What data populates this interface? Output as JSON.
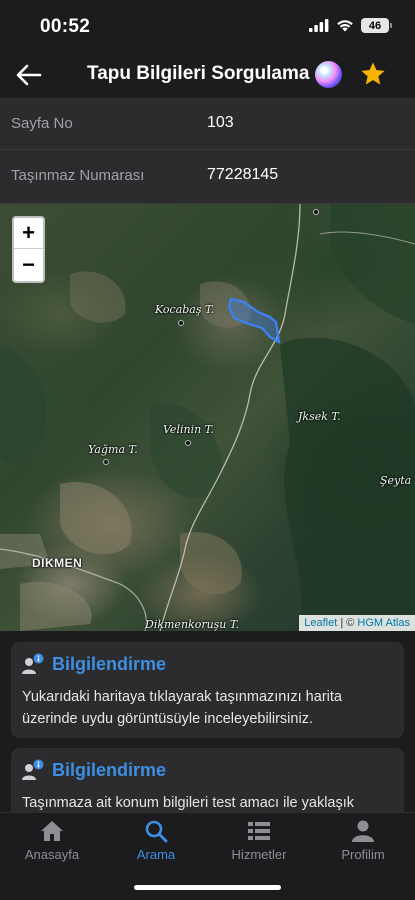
{
  "status_bar": {
    "time": "00:52",
    "battery": "46"
  },
  "nav": {
    "title": "Tapu Bilgileri Sorgulama"
  },
  "info_rows": [
    {
      "label": "Sayfa No",
      "value": "103"
    },
    {
      "label": "Taşınmaz Numarası",
      "value": "77228145"
    }
  ],
  "map": {
    "zoom_in": "+",
    "zoom_out": "−",
    "places": [
      "Kocabaş T.",
      "Jksek T.",
      "Velinin T.",
      "Yağma T.",
      "Şeyta",
      "DIKMEN",
      "Dikmenkoruşu T."
    ],
    "attribution": {
      "leaflet": "Leaflet",
      "separator": " | © ",
      "source": "HGM Atlas"
    },
    "parcel_color": "#3b82f6"
  },
  "cards": [
    {
      "title": "Bilgilendirme",
      "text": "Yukarıdaki haritaya tıklayarak taşınmazınızı harita üzerinde uydu görüntüsüyle inceleyebilirsiniz."
    },
    {
      "title": "Bilgilendirme",
      "text": "Taşınmaza ait konum bilgileri test amacı ile yaklaşık"
    }
  ],
  "tabs": [
    {
      "label": "Anasayfa",
      "icon": "home-icon"
    },
    {
      "label": "Arama",
      "icon": "search-icon",
      "active": true
    },
    {
      "label": "Hizmetler",
      "icon": "list-icon"
    },
    {
      "label": "Profilim",
      "icon": "person-icon"
    }
  ],
  "colors": {
    "accent": "#3d8fe3",
    "star": "#f5b400",
    "background": "#1c1c1e",
    "row_bg": "#2c2c2e"
  }
}
